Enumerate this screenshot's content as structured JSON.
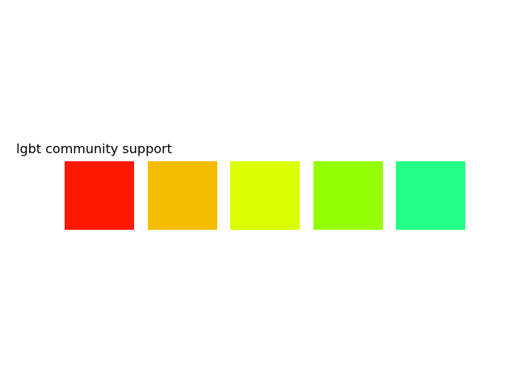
{
  "title": "lgbt community support",
  "swatches": [
    {
      "color": "#ff1900"
    },
    {
      "color": "#f5bd00"
    },
    {
      "color": "#dbff00"
    },
    {
      "color": "#94ff00"
    },
    {
      "color": "#24ff85"
    }
  ]
}
